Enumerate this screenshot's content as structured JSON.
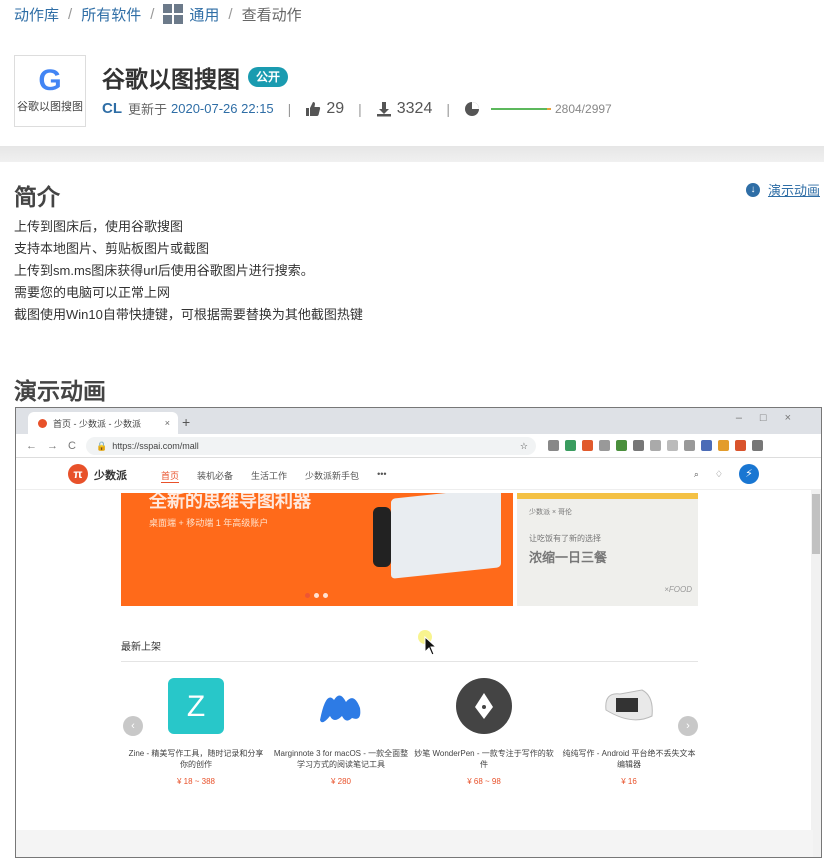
{
  "breadcrumb": {
    "items": [
      "动作库",
      "所有软件",
      "通用"
    ],
    "current": "查看动作"
  },
  "app": {
    "logo_letter": "G",
    "logo_label": "谷歌以图搜图",
    "title": "谷歌以图搜图",
    "badge": "公开",
    "author": "CL",
    "updated_prefix": "更新于",
    "updated_date": "2020-07-26 22:15",
    "likes": "29",
    "downloads": "3324",
    "usage_ratio": "2804/2997",
    "usage_fraction": 0.9356
  },
  "intro": {
    "heading": "简介",
    "demo_link": "演示动画",
    "lines": [
      "上传到图床后，使用谷歌搜图",
      "支持本地图片、剪贴板图片或截图",
      "上传到sm.ms图床获得url后使用谷歌图片进行搜索。",
      "需要您的电脑可以正常上网",
      "截图使用Win10自带快捷键，可根据需要替换为其他截图热键"
    ]
  },
  "demo": {
    "heading": "演示动画",
    "browser": {
      "tab_title": "首页 - 少数派 - 少数派",
      "url": "https://sspai.com/mall",
      "site_name": "少数派",
      "nav": [
        "首页",
        "装机必备",
        "生活工作",
        "少数派新手包",
        "•••"
      ],
      "banner_left_title": "全新的思维导图利器",
      "banner_left_sub": "桌面端 + 移动端 1 年高级账户",
      "banner_right_brand": "少数派 × 哥伦",
      "banner_right_line1": "让吃饭有了新的选择",
      "banner_right_line2": "浓缩一日三餐",
      "banner_right_tag": "×FOOD",
      "section": "最新上架",
      "cards": [
        {
          "name": "Zine - 精美写作工具，随时记录和分享你的创作",
          "price": "¥ 18 ~ 388"
        },
        {
          "name": "Marginnote 3 for macOS - 一款全面整学习方式的阅读笔记工具",
          "price": "¥ 280"
        },
        {
          "name": "妙笔 WonderPen - 一款专注于写作的软件",
          "price": "¥ 68 ~ 98"
        },
        {
          "name": "纯纯写作 - Android 平台绝不丢失文本编辑器",
          "price": "¥ 16"
        }
      ]
    }
  }
}
